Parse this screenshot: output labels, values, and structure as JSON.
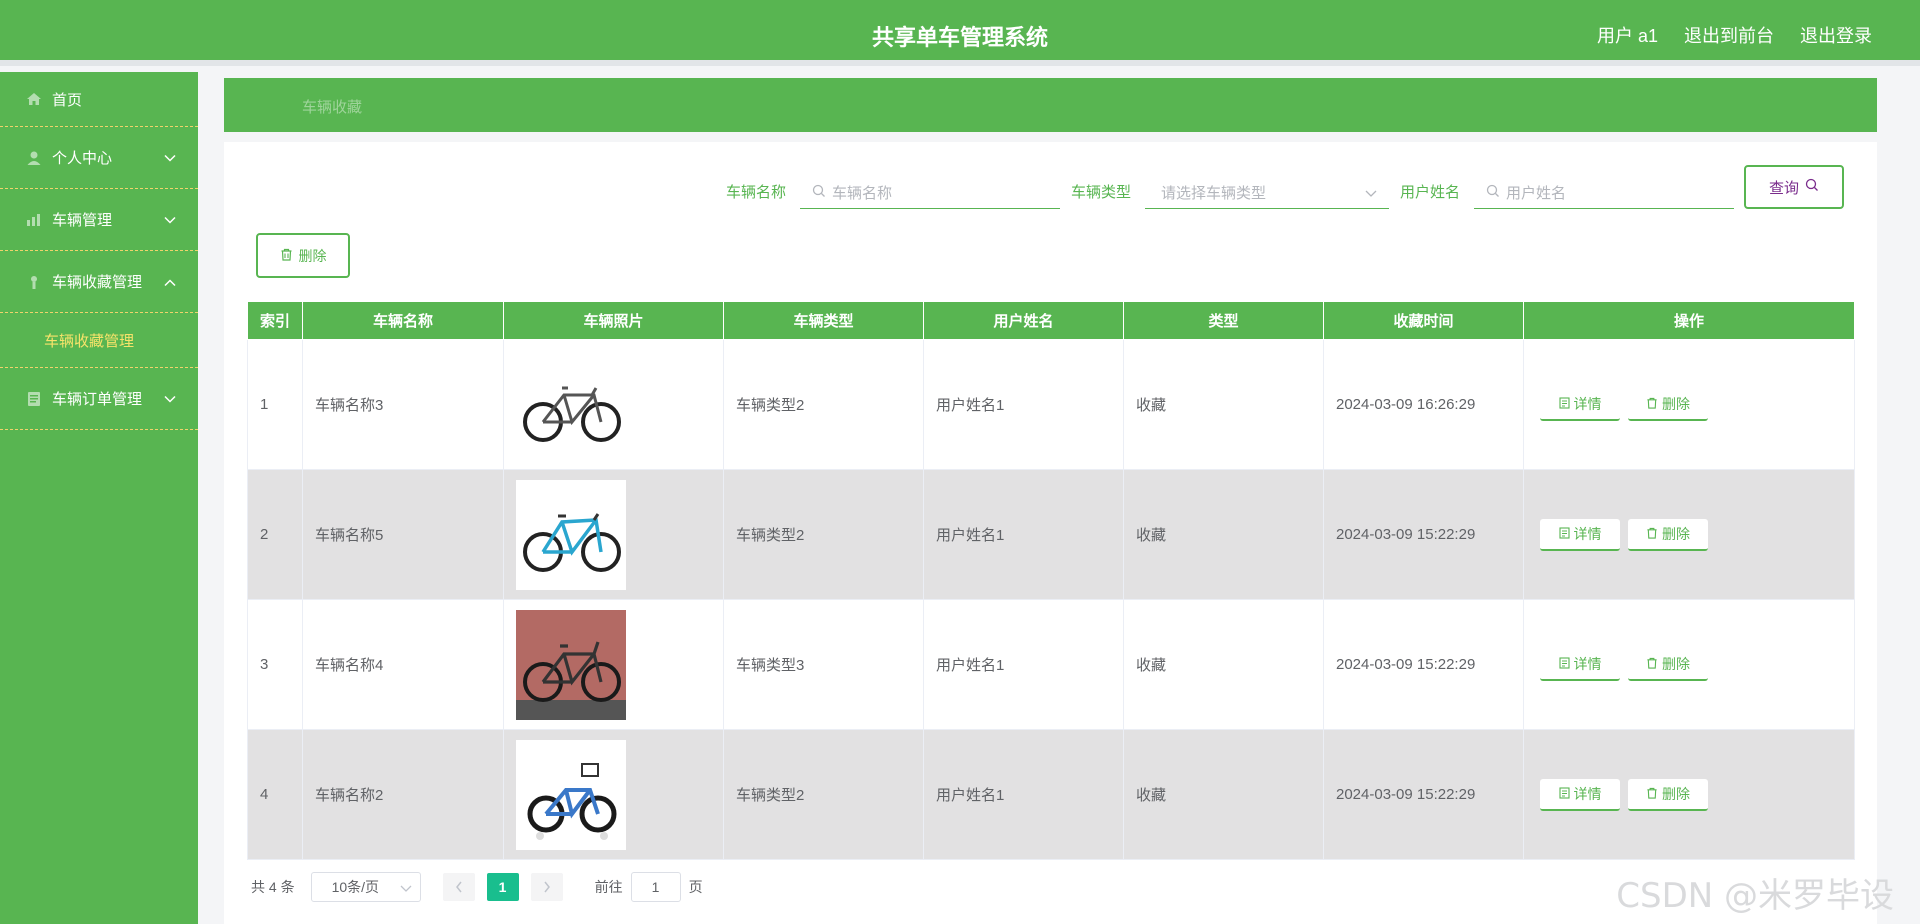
{
  "header": {
    "title": "共享单车管理系统",
    "user": "用户 a1",
    "to_front": "退出到前台",
    "logout": "退出登录"
  },
  "sidebar": {
    "items": [
      {
        "label": "首页",
        "icon": "home-icon"
      },
      {
        "label": "个人中心",
        "icon": "user-icon"
      },
      {
        "label": "车辆管理",
        "icon": "bike-icon"
      },
      {
        "label": "车辆收藏管理",
        "icon": "star-icon",
        "expanded": true
      },
      {
        "label": "车辆订单管理",
        "icon": "order-icon"
      }
    ],
    "sub_item": "车辆收藏管理"
  },
  "breadcrumb": "车辆收藏",
  "search": {
    "name_label": "车辆名称",
    "name_placeholder": "车辆名称",
    "type_label": "车辆类型",
    "type_placeholder": "请选择车辆类型",
    "user_label": "用户姓名",
    "user_placeholder": "用户姓名",
    "query_label": "查询"
  },
  "toolbar": {
    "delete_label": "删除"
  },
  "table": {
    "headers": [
      "索引",
      "车辆名称",
      "车辆照片",
      "车辆类型",
      "用户姓名",
      "类型",
      "收藏时间",
      "操作"
    ],
    "rows": [
      {
        "index": "1",
        "name": "车辆名称3",
        "type": "车辆类型2",
        "user": "用户姓名1",
        "kind": "收藏",
        "time": "2024-03-09 16:26:29"
      },
      {
        "index": "2",
        "name": "车辆名称5",
        "type": "车辆类型2",
        "user": "用户姓名1",
        "kind": "收藏",
        "time": "2024-03-09 15:22:29"
      },
      {
        "index": "3",
        "name": "车辆名称4",
        "type": "车辆类型3",
        "user": "用户姓名1",
        "kind": "收藏",
        "time": "2024-03-09 15:22:29"
      },
      {
        "index": "4",
        "name": "车辆名称2",
        "type": "车辆类型2",
        "user": "用户姓名1",
        "kind": "收藏",
        "time": "2024-03-09 15:22:29"
      }
    ],
    "detail_label": "详情",
    "delete_label": "删除"
  },
  "pager": {
    "total": "共 4 条",
    "page_size": "10条/页",
    "current": "1",
    "goto": "前往",
    "goto_value": "1",
    "page_unit": "页"
  },
  "watermark": "CSDN @米罗毕设",
  "colors": {
    "accent": "#58b551",
    "submenu": "#f7e36a",
    "active_page": "#19be8e"
  }
}
